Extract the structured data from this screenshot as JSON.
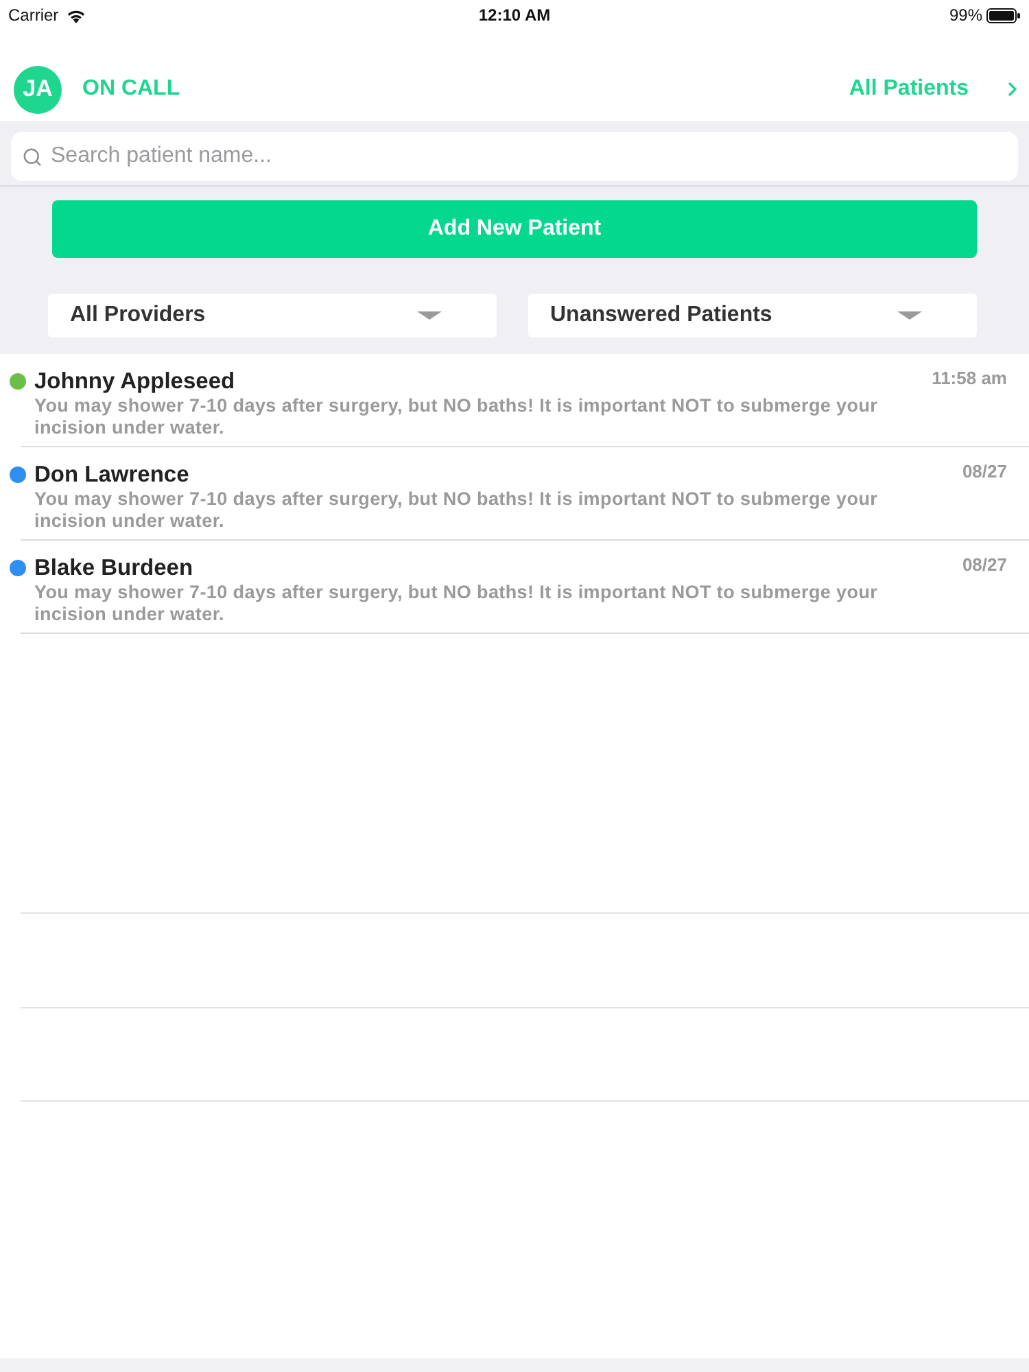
{
  "status_bar": {
    "carrier": "Carrier",
    "time": "12:10 AM",
    "battery": "99%"
  },
  "header": {
    "avatar_initials": "JA",
    "status": "ON CALL",
    "link": "All Patients"
  },
  "search": {
    "placeholder": "Search patient name..."
  },
  "add_button": "Add New Patient",
  "filters": [
    {
      "label": "All Providers"
    },
    {
      "label": "Unanswered Patients"
    }
  ],
  "patients": [
    {
      "name": "Johnny Appleseed",
      "message": "You may shower 7-10 days after surgery, but NO baths! It is important NOT to submerge your incision under water.",
      "time": "11:58 am",
      "color": "#6abf4b"
    },
    {
      "name": "Don Lawrence",
      "message": "You may shower 7-10 days after surgery, but NO baths! It is important NOT to submerge your incision under water.",
      "time": "08/27",
      "color": "#2f8ff0"
    },
    {
      "name": "Blake Burdeen",
      "message": "You may shower 7-10 days after surgery, but NO baths! It is important NOT to submerge your incision under water.",
      "time": "08/27",
      "color": "#2f8ff0"
    }
  ]
}
